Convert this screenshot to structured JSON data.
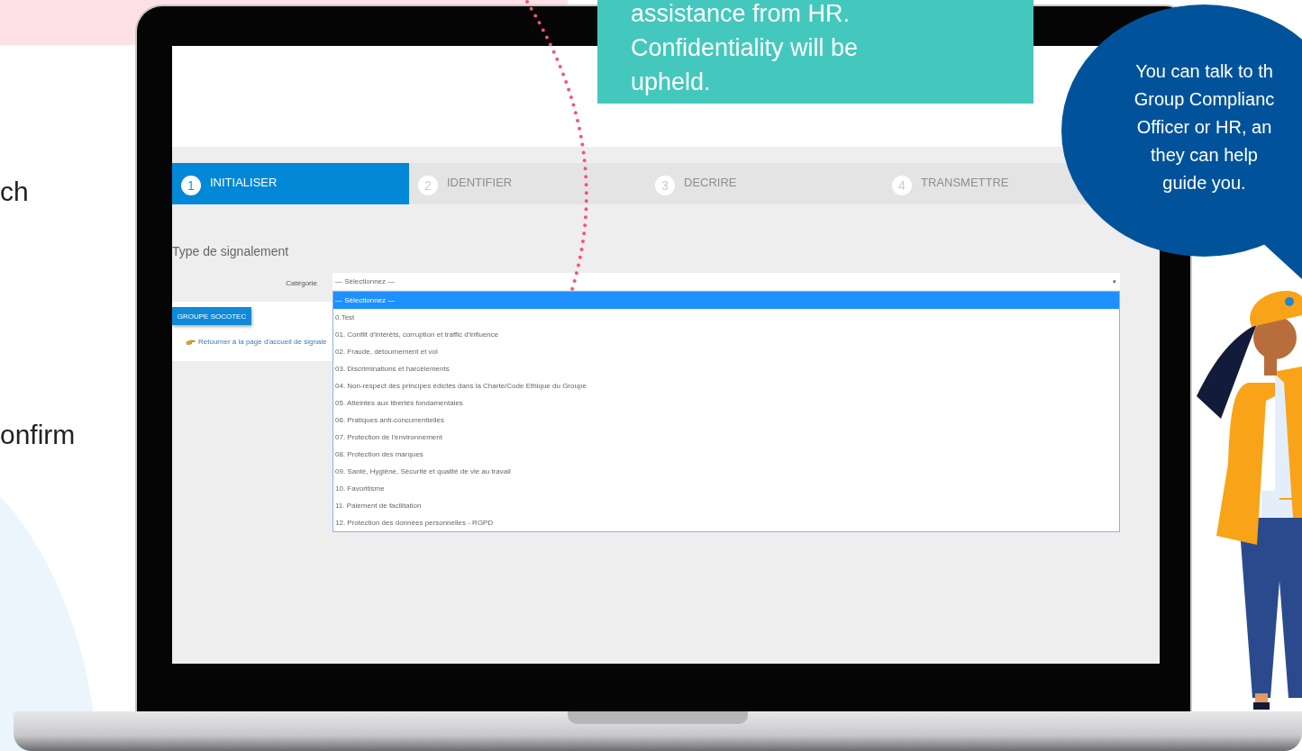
{
  "slide": {
    "text_fragments": [
      "ch",
      "onfirm"
    ]
  },
  "callout": {
    "lines": [
      "assistance from HR.",
      "Confidentiality will be",
      "upheld."
    ]
  },
  "speech_bubble": {
    "lines": [
      "You can talk to th",
      "Group Complianc",
      "Officer or HR, an",
      "they can help",
      "guide you."
    ]
  },
  "screen": {
    "steps": [
      {
        "number": "1",
        "label": "INITIALISER",
        "selected": true
      },
      {
        "number": "2",
        "label": "IDENTIFIER",
        "selected": false
      },
      {
        "number": "3",
        "label": "DECRIRE",
        "selected": false
      },
      {
        "number": "4",
        "label": "TRANSMETTRE",
        "selected": false
      }
    ],
    "section_title": "Type de signalement",
    "category": {
      "label": "Catégorie",
      "value": "— Sélectionnez —",
      "caret": "▾",
      "expanded": true,
      "options": [
        {
          "label": "— Sélectionnez —",
          "selected": true
        },
        {
          "label": "0.Test",
          "selected": false
        },
        {
          "label": "01. Conflit d'intérêts, corruption et traffic d'influence",
          "selected": false
        },
        {
          "label": "02. Fraude, détournement et vol",
          "selected": false
        },
        {
          "label": "03. Discriminations et harcèlements",
          "selected": false
        },
        {
          "label": "04. Non-respect des principes édictés dans la Charte/Code Ethique du Groupe",
          "selected": false
        },
        {
          "label": "05. Atteintes aux libertés fondamentales",
          "selected": false
        },
        {
          "label": "06. Pratiques anti-concurrentielles",
          "selected": false
        },
        {
          "label": "07. Protection de l'environnement",
          "selected": false
        },
        {
          "label": "08. Protection des marques",
          "selected": false
        },
        {
          "label": "09. Santé, Hygiène, Sécurité et qualité de vie au travail",
          "selected": false
        },
        {
          "label": "10. Favoritisme",
          "selected": false
        },
        {
          "label": "11. Paiement de facilitation",
          "selected": false
        },
        {
          "label": "12. Protection des données personnelles - RGPD",
          "selected": false
        }
      ]
    },
    "button": "GROUPE SOCOTEC",
    "link": "Retourner à la page d'accueil de signale"
  }
}
